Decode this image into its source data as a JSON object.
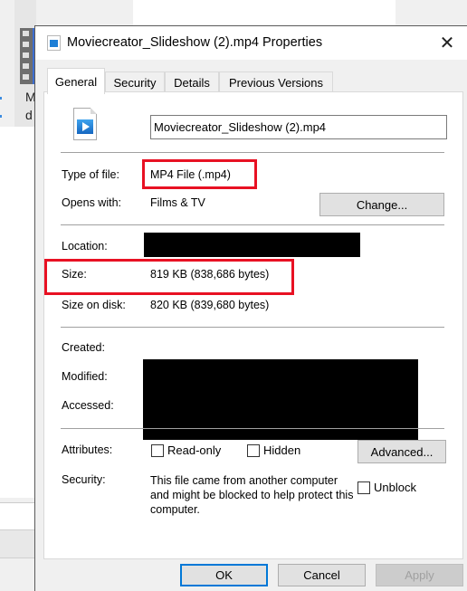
{
  "background": {
    "explorer_item_label_line1": "M",
    "explorer_item_label_line2": "d"
  },
  "dialog": {
    "title": "Moviecreator_Slideshow (2).mp4 Properties",
    "close_icon": "close-icon",
    "tabs": [
      {
        "label": "General",
        "active": true
      },
      {
        "label": "Security",
        "active": false
      },
      {
        "label": "Details",
        "active": false
      },
      {
        "label": "Previous Versions",
        "active": false
      }
    ],
    "general": {
      "file_icon": "video-file-icon",
      "file_name": "Moviecreator_Slideshow (2).mp4",
      "type_of_file_label": "Type of file:",
      "type_of_file_value": "MP4 File (.mp4)",
      "opens_with_label": "Opens with:",
      "opens_with_value": "Films & TV",
      "change_button": "Change...",
      "location_label": "Location:",
      "size_label": "Size:",
      "size_value": "819 KB (838,686 bytes)",
      "size_on_disk_label": "Size on disk:",
      "size_on_disk_value": "820 KB (839,680 bytes)",
      "created_label": "Created:",
      "modified_label": "Modified:",
      "accessed_label": "Accessed:",
      "attributes_label": "Attributes:",
      "read_only_label": "Read-only",
      "read_only_checked": false,
      "hidden_label": "Hidden",
      "hidden_checked": false,
      "advanced_button": "Advanced...",
      "security_label": "Security:",
      "security_text": "This file came from another computer and might be blocked to help protect this computer.",
      "unblock_label": "Unblock",
      "unblock_checked": false
    },
    "footer": {
      "ok": "OK",
      "cancel": "Cancel",
      "apply": "Apply"
    },
    "highlight_color": "#e81123",
    "accent_color": "#0078d7"
  }
}
